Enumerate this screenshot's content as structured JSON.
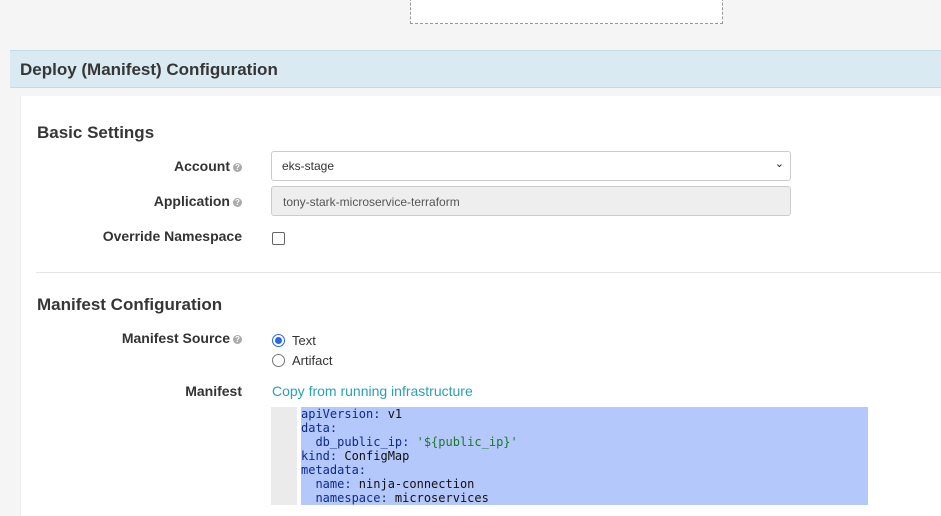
{
  "stage": {
    "title": "Deploy (Manifest) Configuration"
  },
  "basic": {
    "title": "Basic Settings",
    "account_label": "Account",
    "account_value": "eks-stage",
    "application_label": "Application",
    "application_value": "tony-stark-microservice-terraform",
    "override_ns_label": "Override Namespace",
    "override_ns_checked": false
  },
  "manifest": {
    "title": "Manifest Configuration",
    "source_label": "Manifest Source",
    "source_options": [
      "Text",
      "Artifact"
    ],
    "source_selected": "Text",
    "manifest_label": "Manifest",
    "copy_link": "Copy from running infrastructure",
    "lines": [
      {
        "indent": "",
        "key": "apiVersion:",
        "value": " v1",
        "value_type": "plain"
      },
      {
        "indent": "",
        "key": "data:",
        "value": "",
        "value_type": "plain"
      },
      {
        "indent": "  ",
        "key": "db_public_ip:",
        "value": " '${public_ip}'",
        "value_type": "string"
      },
      {
        "indent": "",
        "key": "kind:",
        "value": " ConfigMap",
        "value_type": "plain"
      },
      {
        "indent": "",
        "key": "metadata:",
        "value": "",
        "value_type": "plain"
      },
      {
        "indent": "  ",
        "key": "name:",
        "value": " ninja-connection",
        "value_type": "plain"
      },
      {
        "indent": "  ",
        "key": "namespace:",
        "value": " microservices",
        "value_type": "plain"
      }
    ]
  },
  "colors": {
    "header_bg": "#d9eaf2",
    "selection": "#b5c8fb",
    "link": "#2a9fb8",
    "radio_accent": "#2766e5"
  }
}
